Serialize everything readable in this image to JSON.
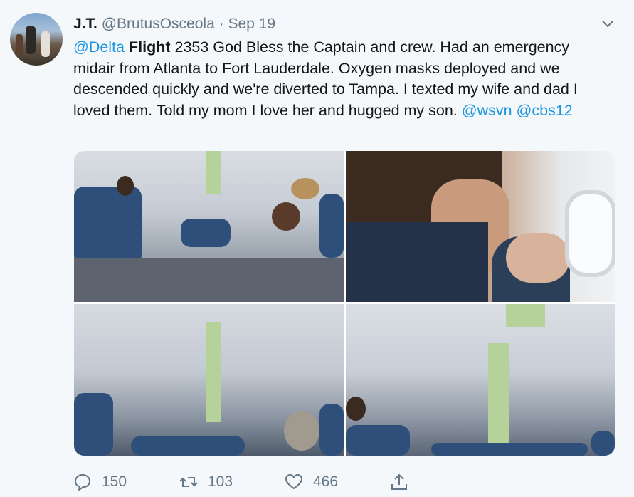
{
  "tweet": {
    "author": {
      "name": "J.T.",
      "handle": "@BrutusOsceola",
      "separator": "·",
      "date": "Sep 19"
    },
    "text": {
      "mention1": "@Delta",
      "bold_word": "Flight",
      "body": " 2353 God Bless the Captain and crew. Had an emergency midair from Atlanta to Fort Lauderdale. Oxygen masks deployed and we descended quickly and we're diverted to Tampa. I texted my wife and dad I loved them. Told my mom I love her and hugged my son. ",
      "mention2": "@wsvn",
      "space": " ",
      "mention3": "@cbs12"
    },
    "actions": {
      "replies": "150",
      "retweets": "103",
      "likes": "466"
    },
    "icons": [
      "chevron-down-icon",
      "reply-icon",
      "retweet-icon",
      "like-icon",
      "share-icon"
    ],
    "colors": {
      "link": "#1b95e0",
      "muted": "#657786",
      "background": "#f5f8fa"
    }
  }
}
